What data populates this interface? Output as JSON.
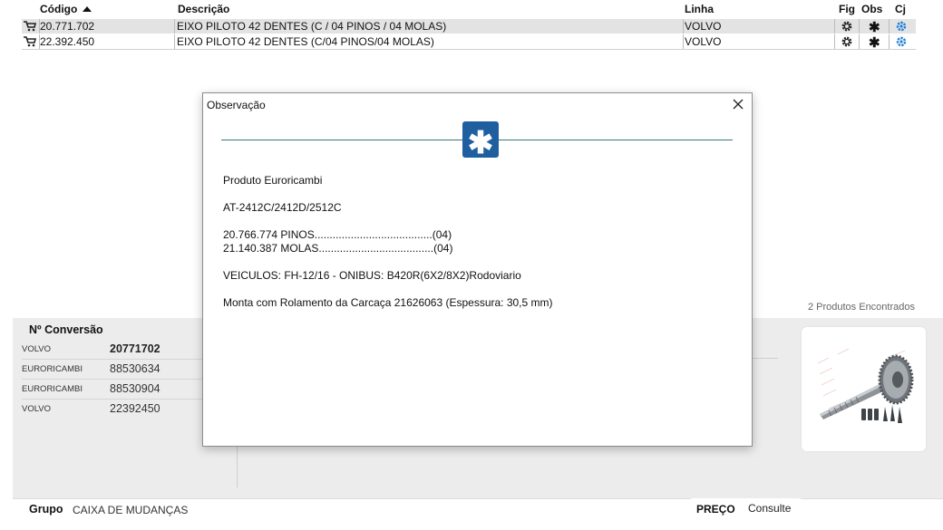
{
  "table": {
    "headers": {
      "codigo": "Código",
      "descricao": "Descrição",
      "linha": "Linha",
      "fig": "Fig",
      "obs": "Obs",
      "cj": "Cj"
    },
    "rows": [
      {
        "codigo": "20.771.702",
        "descricao": "EIXO PILOTO 42 DENTES (C / 04 PINOS / 04 MOLAS)",
        "linha": "VOLVO",
        "obs": "✱"
      },
      {
        "codigo": "22.392.450",
        "descricao": "EIXO PILOTO 42 DENTES (C/04 PINOS/04 MOLAS)",
        "linha": "VOLVO",
        "obs": "✱"
      }
    ]
  },
  "found_text": "2 Produtos Encontrados",
  "conversao": {
    "title": "Nº Conversão",
    "rows": [
      {
        "brand": "VOLVO",
        "number": "20771702"
      },
      {
        "brand": "EURORICAMBI",
        "number": "88530634"
      },
      {
        "brand": "EURORICAMBI",
        "number": "88530904"
      },
      {
        "brand": "VOLVO",
        "number": "22392450"
      }
    ]
  },
  "footer": {
    "grupo_label": "Grupo",
    "grupo_value": "CAIXA DE MUDANÇAS",
    "preco_label": "PREÇO",
    "preco_value": "Consulte"
  },
  "modal": {
    "title": "Observação",
    "icon_glyph": "✱",
    "lines": {
      "l1": "Produto Euroricambi",
      "l2": "AT-2412C/2412D/2512C",
      "l3": "20.766.774 PINOS.......................................(04)",
      "l4": "21.140.387 MOLAS......................................(04)",
      "l5": "VEICULOS: FH-12/16 - ONIBUS: B420R(6X2/8X2)Rodoviario",
      "l6": "Monta com Rolamento da Carcaça 21626063 (Espessura: 30,5 mm)"
    }
  },
  "colors": {
    "accent_blue": "#1f5f9f",
    "rule_teal": "#2d7a78",
    "cj_icon": "#1e7fd6"
  },
  "icons": [
    "cart-icon",
    "gear-icon",
    "asterisk-icon",
    "link-icon",
    "close-icon",
    "sort-up-icon"
  ]
}
